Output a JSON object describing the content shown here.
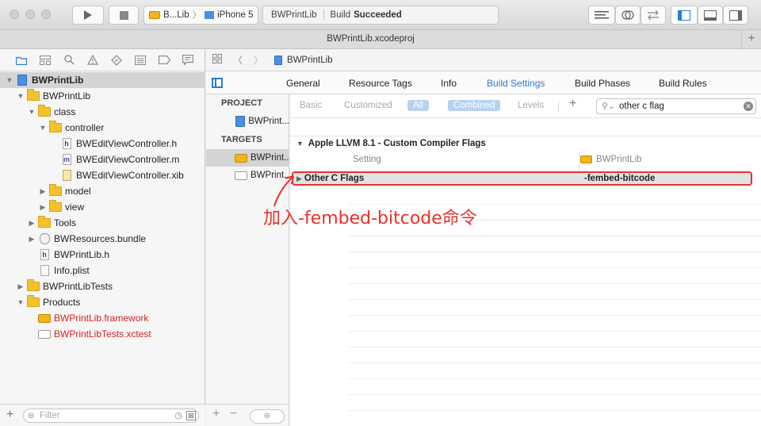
{
  "toolbar": {
    "scheme_target": "B...Lib",
    "scheme_device": "iPhone 5",
    "activity_project": "BWPrintLib",
    "activity_status_prefix": "Build",
    "activity_status": "Succeeded"
  },
  "tab": {
    "title": "BWPrintLib.xcodeproj",
    "add": "+"
  },
  "navigator": {
    "items": [
      {
        "label": "BWPrintLib",
        "kind": "project",
        "depth": 0,
        "open": true,
        "selected": true,
        "bold": true
      },
      {
        "label": "BWPrintLib",
        "kind": "folder",
        "depth": 1,
        "open": true
      },
      {
        "label": "class",
        "kind": "folder",
        "depth": 2,
        "open": true
      },
      {
        "label": "controller",
        "kind": "folder",
        "depth": 3,
        "open": true
      },
      {
        "label": "BWEditViewController.h",
        "kind": "h",
        "depth": 4
      },
      {
        "label": "BWEditViewController.m",
        "kind": "m",
        "depth": 4
      },
      {
        "label": "BWEditViewController.xib",
        "kind": "xib",
        "depth": 4
      },
      {
        "label": "model",
        "kind": "folder",
        "depth": 3,
        "open": false
      },
      {
        "label": "view",
        "kind": "folder",
        "depth": 3,
        "open": false
      },
      {
        "label": "Tools",
        "kind": "folder",
        "depth": 2,
        "open": false
      },
      {
        "label": "BWResources.bundle",
        "kind": "bundle",
        "depth": 2,
        "open": false
      },
      {
        "label": "BWPrintLib.h",
        "kind": "h",
        "depth": 2
      },
      {
        "label": "Info.plist",
        "kind": "plist",
        "depth": 2
      },
      {
        "label": "BWPrintLibTests",
        "kind": "folder",
        "depth": 1,
        "open": false
      },
      {
        "label": "Products",
        "kind": "folder",
        "depth": 1,
        "open": true
      },
      {
        "label": "BWPrintLib.framework",
        "kind": "framework",
        "depth": 2,
        "red": true
      },
      {
        "label": "BWPrintLibTests.xctest",
        "kind": "xctest",
        "depth": 2,
        "red": true
      }
    ],
    "filter_placeholder": "Filter"
  },
  "jumpbar": {
    "crumb": "BWPrintLib"
  },
  "editor_tabs": [
    "General",
    "Resource Tags",
    "Info",
    "Build Settings",
    "Build Phases",
    "Build Rules"
  ],
  "active_tab": "Build Settings",
  "targets_panel": {
    "project_header": "PROJECT",
    "project_item": "BWPrint...",
    "targets_header": "TARGETS",
    "target_items": [
      "BWPrint...",
      "BWPrint..."
    ]
  },
  "settings": {
    "filters": {
      "basic": "Basic",
      "customized": "Customized",
      "all": "All",
      "combined": "Combined",
      "levels": "Levels",
      "add": "+"
    },
    "search_value": "other c flag",
    "group_title": "Apple LLVM 8.1 - Custom Compiler Flags",
    "col_setting": "Setting",
    "col_target": "BWPrintLib",
    "row_name": "Other C Flags",
    "row_value": "-fembed-bitcode"
  },
  "annotation": "加入-fembed-bitcode命令",
  "colors": {
    "accent": "#2d7bd6",
    "highlight": "#e8322b",
    "product_missing": "#d72020"
  }
}
